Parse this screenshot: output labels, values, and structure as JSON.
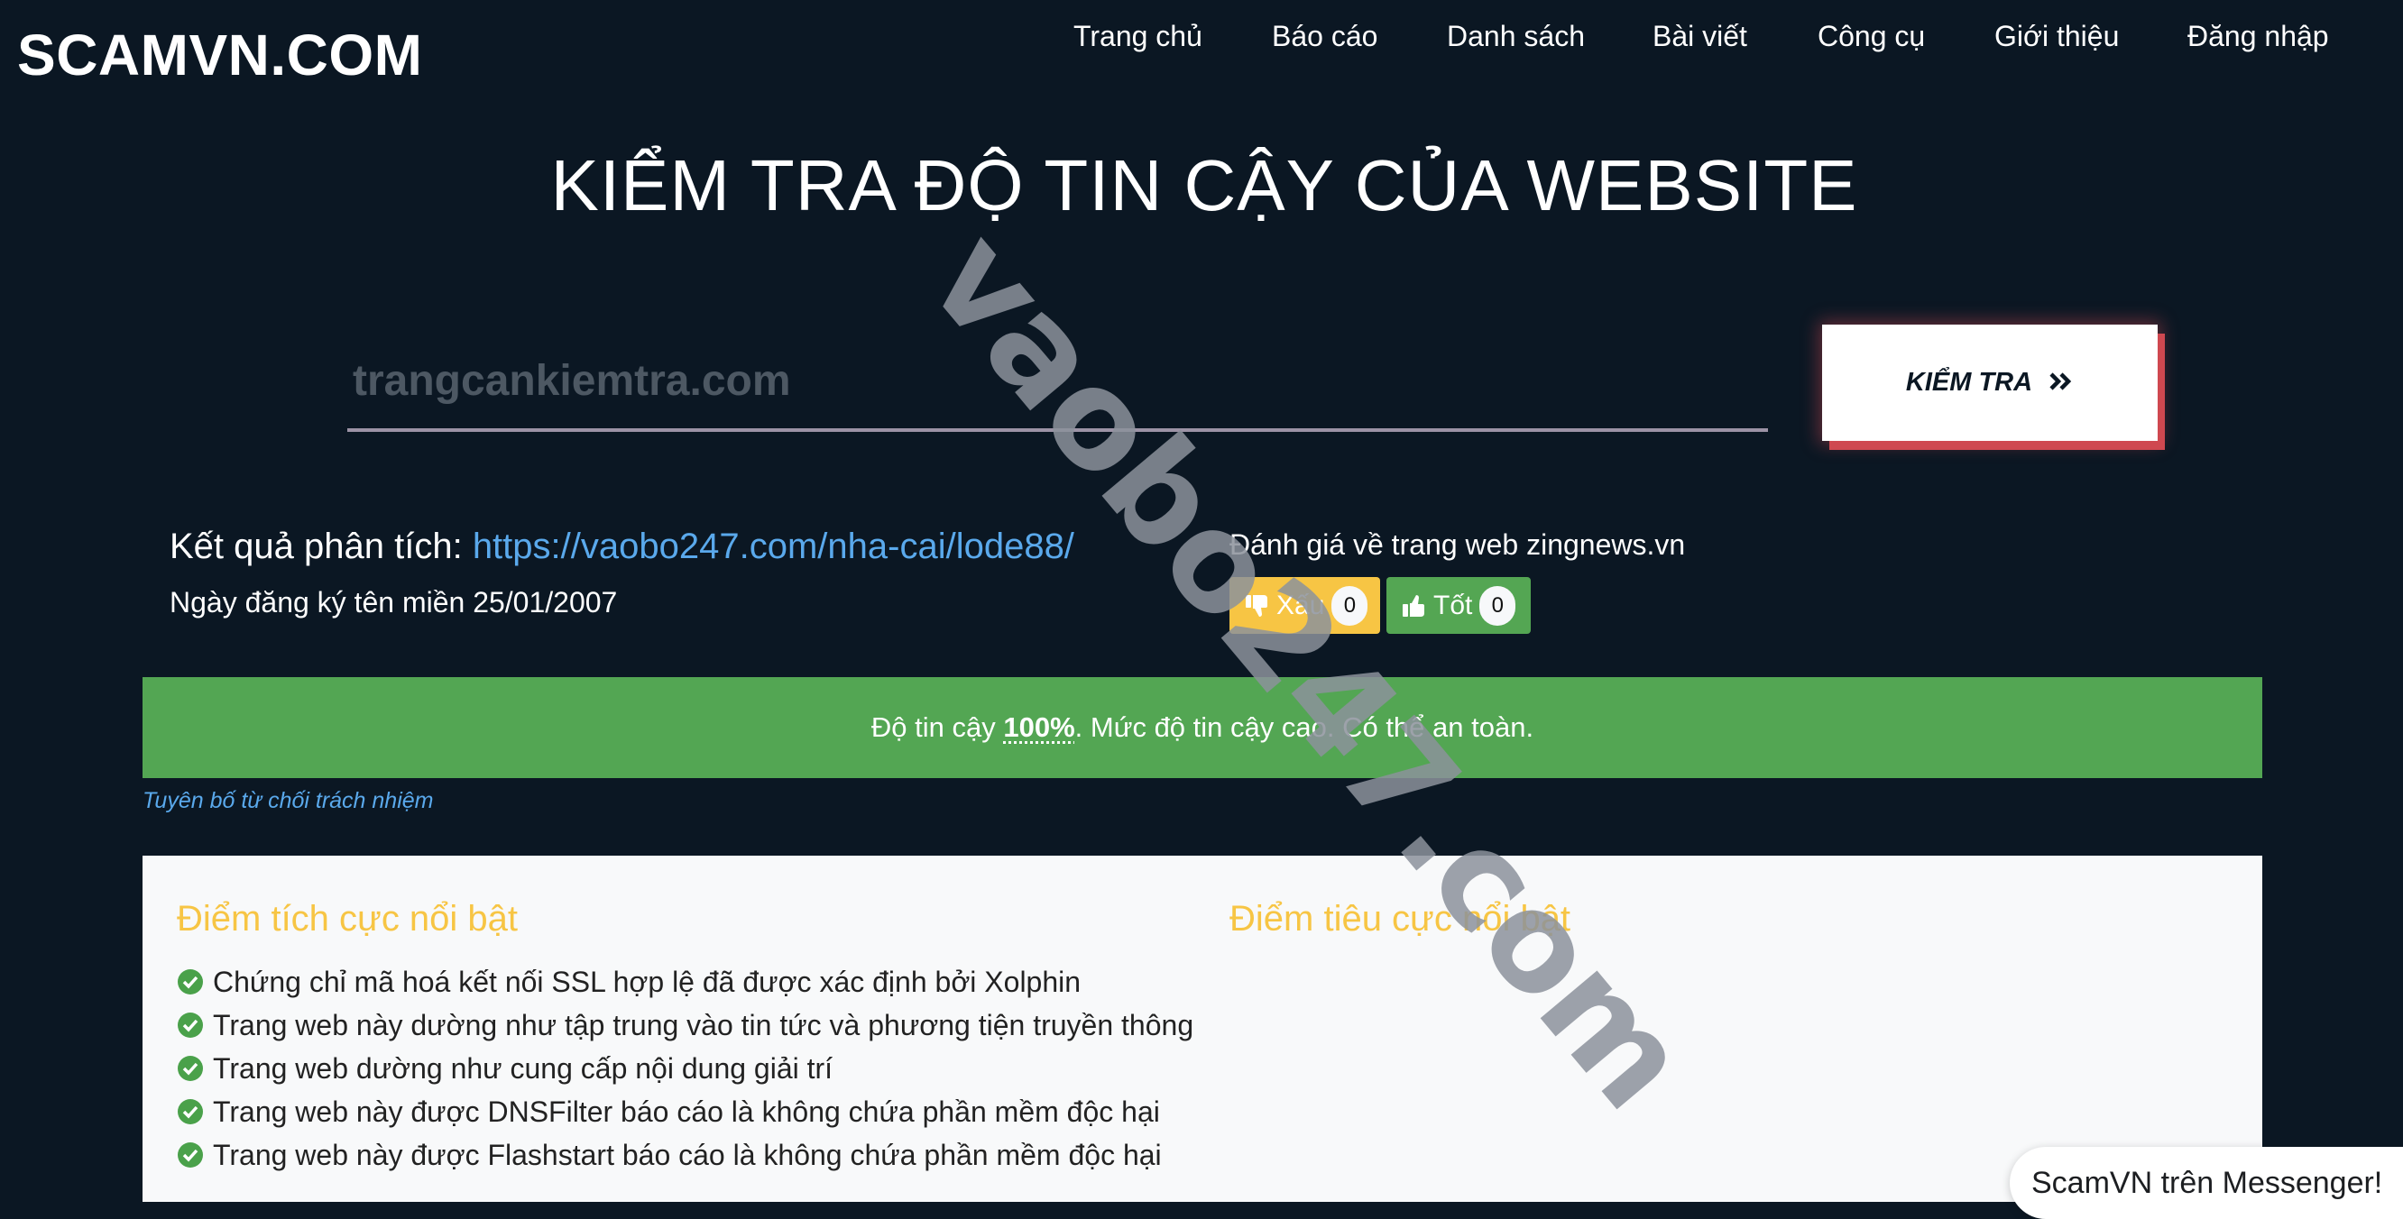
{
  "header": {
    "logo": "SCAMVN.COM",
    "nav": [
      {
        "label": "Trang chủ"
      },
      {
        "label": "Báo cáo"
      },
      {
        "label": "Danh sách"
      },
      {
        "label": "Bài viết"
      },
      {
        "label": "Công cụ"
      },
      {
        "label": "Giới thiệu"
      },
      {
        "label": "Đăng nhập"
      }
    ]
  },
  "hero": {
    "title": "KIỂM TRA ĐỘ TIN CẬY CỦA WEBSITE",
    "search": {
      "placeholder": "trangcankiemtra.com",
      "value": ""
    },
    "check_button": {
      "label": "KIỂM TRA",
      "icon": "double-chevron-right-icon"
    }
  },
  "result": {
    "label": "Kết quả phân tích:",
    "url": "https://vaobo247.com/nha-cai/lode88/",
    "domain_registration": "Ngày đăng ký tên miền 25/01/2007"
  },
  "rating": {
    "title": "Đánh giá về trang web zingnews.vn",
    "bad": {
      "label": "Xấu",
      "count": "0",
      "icon": "thumbs-down-icon"
    },
    "good": {
      "label": "Tốt",
      "count": "0",
      "icon": "thumbs-up-icon"
    }
  },
  "trust_banner": {
    "prefix": "Độ tin cậy ",
    "percent": "100%",
    "suffix": ". Mức độ tin cậy cao. Có thể an toàn.",
    "color": "#53a653"
  },
  "disclaimer": "Tuyên bố từ chối trách nhiệm",
  "highlights": {
    "positive_title": "Điểm tích cực nổi bật",
    "negative_title": "Điểm tiêu cực nổi bật",
    "positive": [
      "Chứng chỉ mã hoá kết nối SSL hợp lệ đã được xác định bởi Xolphin",
      "Trang web này dường như tập trung vào tin tức và phương tiện truyền thông",
      "Trang web dường như cung cấp nội dung giải trí",
      "Trang web này được DNSFilter báo cáo là không chứa phần mềm độc hại",
      "Trang web này được Flashstart báo cáo là không chứa phần mềm độc hại"
    ],
    "negative": []
  },
  "messenger": {
    "label": "ScamVN trên Messenger!"
  },
  "watermark": "vaobo247.com",
  "colors": {
    "background": "#0b1723",
    "accent_red": "#cf4850",
    "link_blue": "#5aa9ec",
    "heading_yellow": "#f7c544",
    "good_green": "#54a653"
  }
}
